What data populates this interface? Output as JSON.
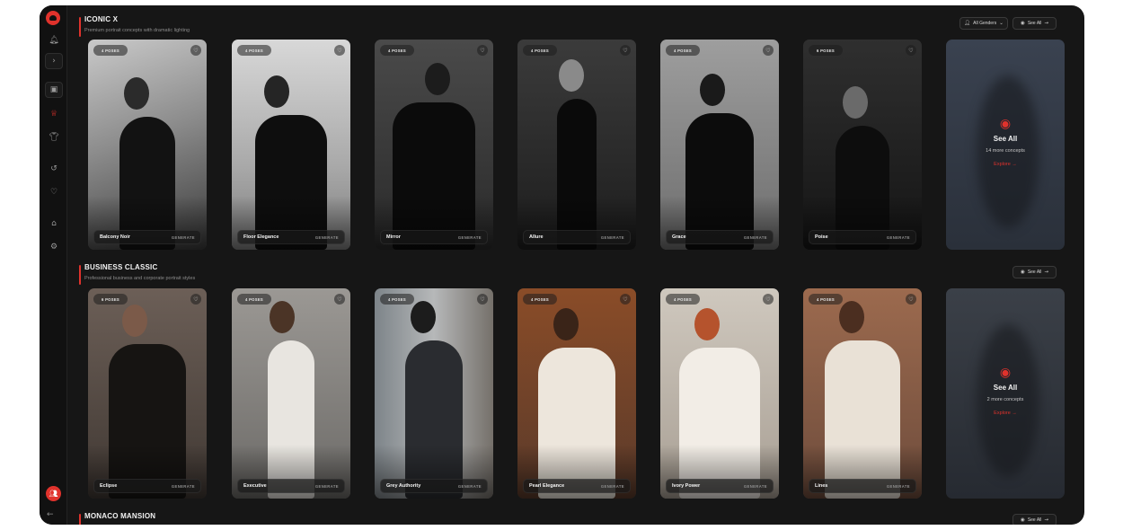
{
  "sidebar": {
    "logo": "logo-icon",
    "items": [
      {
        "name": "notifications",
        "icon": "bell-icon",
        "glyph": "🔔︎"
      },
      {
        "name": "expand",
        "icon": "chevron-right-icon",
        "glyph": "›"
      },
      {
        "name": "gallery",
        "icon": "image-icon",
        "glyph": "▣"
      },
      {
        "name": "crown",
        "icon": "crown-icon",
        "glyph": "♕"
      },
      {
        "name": "outfits",
        "icon": "shirt-icon",
        "glyph": "👕︎"
      },
      {
        "name": "history",
        "icon": "history-icon",
        "glyph": "↺"
      },
      {
        "name": "favorites",
        "icon": "heart-icon",
        "glyph": "♡"
      },
      {
        "name": "home",
        "icon": "home-icon",
        "glyph": "⌂"
      },
      {
        "name": "settings",
        "icon": "gear-icon",
        "glyph": "⚙"
      }
    ],
    "avatar_glyph": "👥︎",
    "collapse_glyph": "←"
  },
  "sections": [
    {
      "title": "ICONIC X",
      "subtitle": "Premium portrait concepts with dramatic lighting",
      "gender_filter": "All Genders",
      "see_all_label": "See All",
      "cards": [
        {
          "poses": "4 POSES",
          "name": "Balcony Noir",
          "generate": "GENERATE"
        },
        {
          "poses": "4 POSES",
          "name": "Floor Elegance",
          "generate": "GENERATE"
        },
        {
          "poses": "4 POSES",
          "name": "Mirror",
          "generate": "GENERATE"
        },
        {
          "poses": "4 POSES",
          "name": "Allure",
          "generate": "GENERATE"
        },
        {
          "poses": "4 POSES",
          "name": "Grace",
          "generate": "GENERATE"
        },
        {
          "poses": "6 POSES",
          "name": "Poise",
          "generate": "GENERATE"
        }
      ],
      "see_all_card": {
        "title": "See All",
        "count": "14 more concepts",
        "explore": "Explore →"
      }
    },
    {
      "title": "BUSINESS CLASSIC",
      "subtitle": "Professional business and corporate portrait styles",
      "see_all_label": "See All",
      "cards": [
        {
          "poses": "6 POSES",
          "name": "Eclipse",
          "generate": "GENERATE"
        },
        {
          "poses": "4 POSES",
          "name": "Executive",
          "generate": "GENERATE"
        },
        {
          "poses": "4 POSES",
          "name": "Grey Authority",
          "generate": "GENERATE"
        },
        {
          "poses": "4 POSES",
          "name": "Pearl Elegance",
          "generate": "GENERATE"
        },
        {
          "poses": "4 POSES",
          "name": "Ivory Power",
          "generate": "GENERATE"
        },
        {
          "poses": "4 POSES",
          "name": "Lines",
          "generate": "GENERATE"
        }
      ],
      "see_all_card": {
        "title": "See All",
        "count": "2 more concepts",
        "explore": "Explore →"
      }
    },
    {
      "title": "MONACO MANSION",
      "see_all_label": "See All"
    }
  ]
}
